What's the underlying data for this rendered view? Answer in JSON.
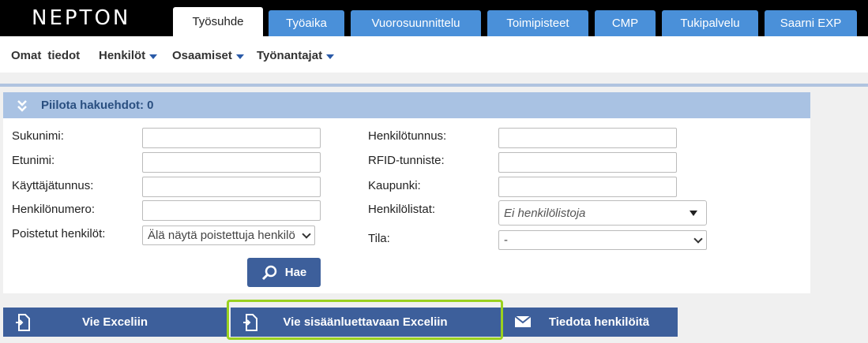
{
  "app": {
    "logo": "NEPTON"
  },
  "tabs": [
    {
      "label": "Työsuhde",
      "active": true
    },
    {
      "label": "Työaika"
    },
    {
      "label": "Vuorosuunnittelu"
    },
    {
      "label": "Toimipisteet"
    },
    {
      "label": "CMP"
    },
    {
      "label": "Tukipalvelu"
    },
    {
      "label": "Saarni EXP"
    }
  ],
  "submenu": {
    "omat": "Omat",
    "tiedot": "tiedot",
    "henkilot": "Henkilöt",
    "osaamiset": "Osaamiset",
    "tyonantajat": "Työnantajat"
  },
  "panel": {
    "title": "Piilota hakuehdot: 0"
  },
  "form": {
    "sukunimi": {
      "label": "Sukunimi:",
      "value": ""
    },
    "etunimi": {
      "label": "Etunimi:",
      "value": ""
    },
    "kayttajatunnus": {
      "label": "Käyttäjätunnus:",
      "value": ""
    },
    "henkilonumero": {
      "label": "Henkilönumero:",
      "value": ""
    },
    "poistetut": {
      "label": "Poistetut henkilöt:",
      "value": "Älä näytä poistettuja henkilö"
    },
    "henkilotunnus": {
      "label": "Henkilötunnus:",
      "value": ""
    },
    "rfid": {
      "label": "RFID-tunniste:",
      "value": ""
    },
    "kaupunki": {
      "label": "Kaupunki:",
      "value": ""
    },
    "henkilolistat": {
      "label": "Henkilölistat:",
      "placeholder": "Ei henkilölistoja"
    },
    "tila": {
      "label": "Tila:",
      "value": "-"
    }
  },
  "buttons": {
    "hae": "Hae",
    "vie_exceliin": "Vie Exceliin",
    "vie_sisaan": "Vie sisäänluettavaan Exceliin",
    "tiedota": "Tiedota henkilöitä"
  },
  "colors": {
    "accent": "#4a90d9",
    "button": "#3d5f9b",
    "panel_head": "#a9c2e3",
    "highlight": "#9ad11f"
  }
}
